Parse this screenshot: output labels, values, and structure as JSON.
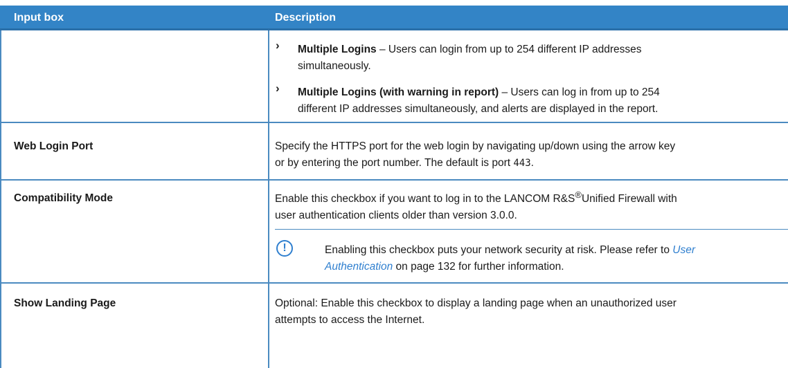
{
  "header": {
    "col1": "Input box",
    "col2": "Description"
  },
  "rows": [
    {
      "bullets": [
        {
          "term": "Multiple Logins",
          "text_line1": " – Users can login from up to 254 different IP addresses",
          "text_line2": "simultaneously."
        },
        {
          "term": "Multiple Logins (with warning in report)",
          "text_line1": " – Users can log in from up to 254",
          "text_line2": "different IP addresses simultaneously, and alerts are displayed in the report."
        }
      ]
    },
    {
      "name": "Web Login Port",
      "desc_line1": "Specify the HTTPS port for the web login by navigating up/down using the arrow key",
      "desc_line2_pre": "or by entering the port number. The default is port ",
      "desc_code": "443",
      "desc_line2_post": "."
    },
    {
      "name": "Compatibility Mode",
      "desc_line1_pre": "Enable this checkbox if you want to log in to the LANCOM R&S",
      "desc_sup": "®",
      "desc_line1_post": "Unified Firewall with",
      "desc_line2": "user authentication clients older than version 3.0.0.",
      "note": {
        "icon": "exclamation-circle-icon",
        "glyph": "!",
        "line1_pre": "Enabling this checkbox puts your network security at risk. Please refer to ",
        "link_part1": "User",
        "link_part2": "Authentication",
        "line2_post": " on page 132 for further information."
      }
    },
    {
      "name": "Show Landing Page",
      "desc_line1": "Optional: Enable this checkbox to display a landing page when an unauthorized user",
      "desc_line2": "attempts to access the Internet."
    }
  ]
}
